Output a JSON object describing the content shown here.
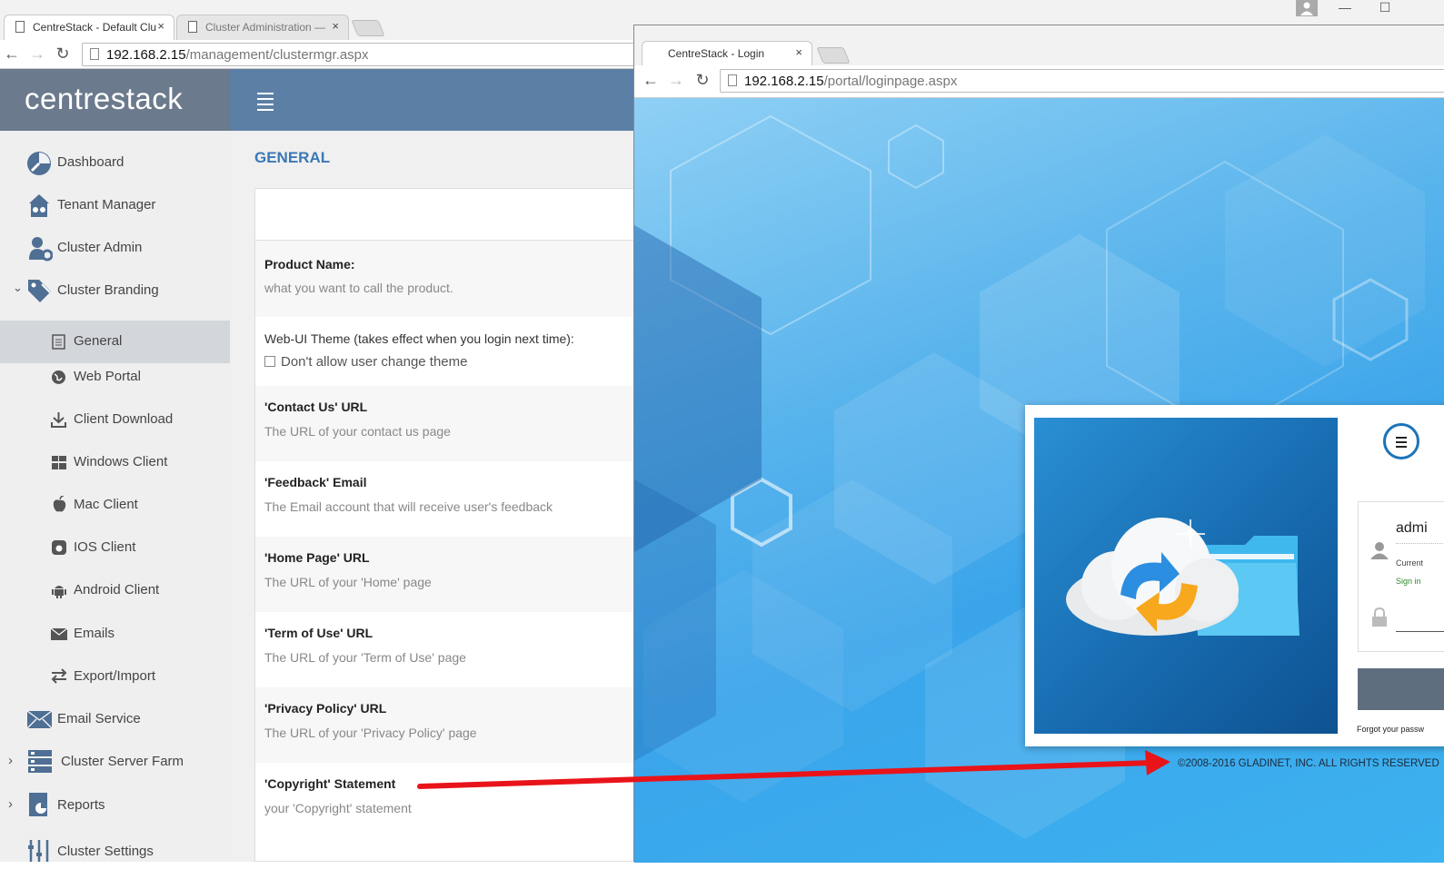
{
  "back_browser": {
    "tabs": [
      {
        "title": "CentreStack - Default Clus",
        "close": "×"
      },
      {
        "title": "Cluster Administration —",
        "close": "×"
      }
    ],
    "url_host": "192.168.2.15",
    "url_path": "/management/clustermgr.aspx"
  },
  "app": {
    "logo_text": "centrestack",
    "sidebar": [
      {
        "label": "Dashboard",
        "icon": "dashboard-icon"
      },
      {
        "label": "Tenant Manager",
        "icon": "tenant-icon"
      },
      {
        "label": "Cluster Admin",
        "icon": "user-gear-icon"
      },
      {
        "label": "Cluster Branding",
        "icon": "tags-icon",
        "expanded": true
      },
      {
        "label": "General",
        "icon": "document-icon",
        "active": true
      },
      {
        "label": "Web Portal",
        "icon": "globe-icon"
      },
      {
        "label": "Client Download",
        "icon": "download-icon"
      },
      {
        "label": "Windows Client",
        "icon": "windows-icon"
      },
      {
        "label": "Mac Client",
        "icon": "apple-icon"
      },
      {
        "label": "IOS Client",
        "icon": "ios-icon"
      },
      {
        "label": "Android Client",
        "icon": "android-icon"
      },
      {
        "label": "Emails",
        "icon": "envelope-icon"
      },
      {
        "label": "Export/Import",
        "icon": "arrows-icon"
      },
      {
        "label": "Email Service",
        "icon": "envelope-icon"
      },
      {
        "label": "Cluster Server Farm",
        "icon": "server-icon"
      },
      {
        "label": "Reports",
        "icon": "report-icon"
      },
      {
        "label": "Cluster Settings",
        "icon": "settings-icon"
      }
    ],
    "section_title": "GENERAL",
    "fields": [
      {
        "label": "Product Name:",
        "desc": "what you want to call the product."
      },
      {
        "label": "Web-UI Theme (takes effect when you login next time):",
        "desc": "Don't allow user change theme"
      },
      {
        "label": "'Contact Us' URL",
        "desc": "The URL of your contact us page"
      },
      {
        "label": "'Feedback' Email",
        "desc": "The Email account that will receive user's feedback"
      },
      {
        "label": "'Home Page' URL",
        "desc": "The URL of your 'Home' page"
      },
      {
        "label": "'Term of Use' URL",
        "desc": "The URL of your 'Term of Use' page"
      },
      {
        "label": "'Privacy Policy' URL",
        "desc": "The URL of your 'Privacy Policy' page"
      },
      {
        "label": "'Copyright' Statement",
        "desc": "your 'Copyright' statement"
      }
    ]
  },
  "front_browser": {
    "tab_title": "CentreStack - Login",
    "tab_close": "×",
    "url_host": "192.168.2.15",
    "url_path": "/portal/loginpage.aspx",
    "login": {
      "username": "admi",
      "user_sub": "Current",
      "signin_link": "Sign in",
      "forgot": "Forgot your passw",
      "copyright": "©2008-2016 GLADINET, INC. ALL RIGHTS RESERVED"
    }
  },
  "window_controls": {
    "minimize": "—",
    "maximize": "☐"
  },
  "colors": {
    "header_blue": "#5c80a5",
    "logo_bg": "#6b7a8c",
    "section_title": "#3a78b5",
    "arrow": "#e8141a"
  }
}
